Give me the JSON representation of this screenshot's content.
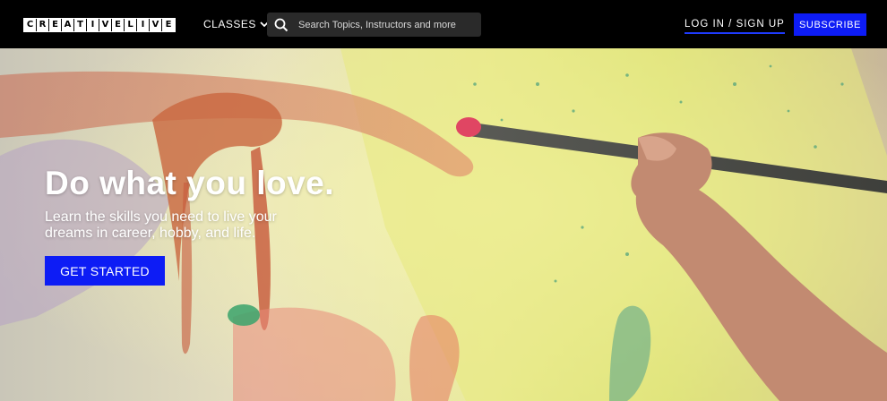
{
  "header": {
    "logo_letters": [
      "C",
      "R",
      "E",
      "A",
      "T",
      "I",
      "V",
      "E",
      "L",
      "I",
      "V",
      "E"
    ],
    "classes_label": "CLASSES",
    "search_placeholder": "Search Topics, Instructors and more",
    "login_label": "LOG IN / SIGN UP",
    "subscribe_label": "SUBSCRIBE"
  },
  "hero": {
    "title": "Do what you love.",
    "subtitle": "Learn the skills you need to live your dreams in career, hobby, and life.",
    "cta_label": "GET STARTED"
  },
  "colors": {
    "nav_bg": "#000000",
    "accent": "#0d1cf5"
  },
  "icons": {
    "search": "search-icon",
    "chevron": "chevron-down-icon"
  }
}
